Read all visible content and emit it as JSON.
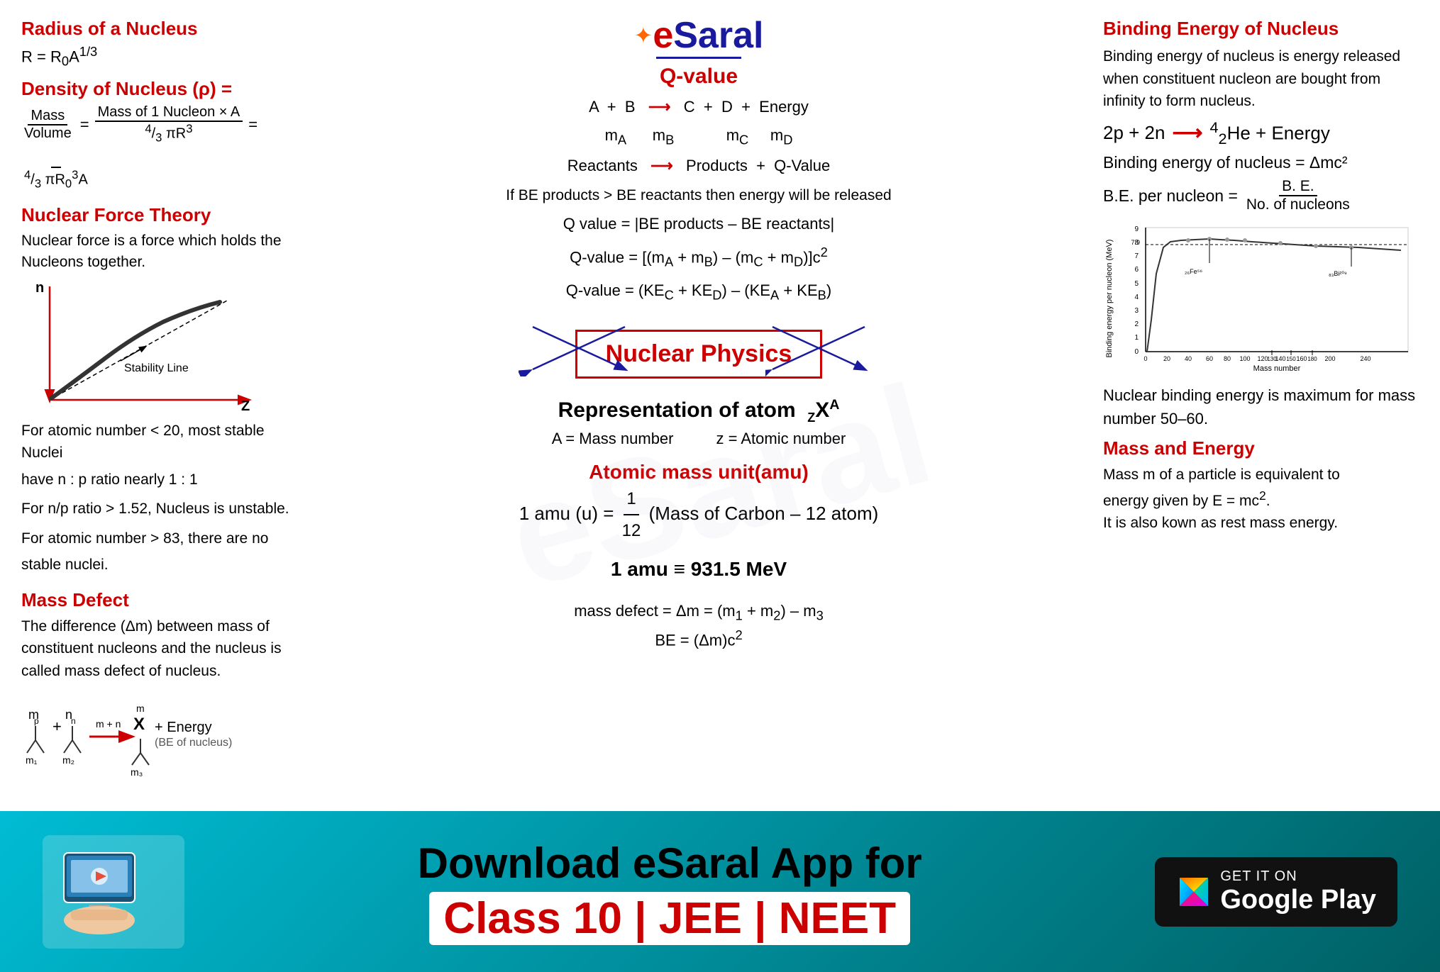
{
  "header": {
    "logo_e": "e",
    "logo_saral": "Saral",
    "logo_star": "✦"
  },
  "left": {
    "radius_title": "Radius of a Nucleus",
    "radius_formula": "R = R₀A¹/³",
    "density_title": "Density of Nucleus (ρ) =",
    "density_fraction_numer": "Mass",
    "density_fraction_denom": "Volume",
    "density_eq1_numer": "Mass of 1 Nucleon × A",
    "density_eq1_denom1": "4/3 πR³",
    "density_eq2_denom2": "4/3 πR₀³A",
    "nf_title": "Nuclear Force Theory",
    "nf_text1": "Nuclear force is a force which holds the",
    "nf_text2": "Nucleons together.",
    "stability_label": "Stability Line",
    "n_label": "n",
    "z_label": "Z",
    "atomic_note1": "For atomic number < 20, most stable Nuclei",
    "atomic_note2": "have n : p ratio nearly 1 : 1",
    "atomic_note3": "For n/p ratio > 1.52, Nucleus is unstable.",
    "atomic_note4": "For atomic number > 83, there are no",
    "atomic_note5": "stable nuclei.",
    "mass_defect_title": "Mass Defect",
    "mass_defect_text1": "The difference (Δm) between mass of",
    "mass_defect_text2": "constituent nucleons and the nucleus is",
    "mass_defect_text3": "called mass defect of nucleus."
  },
  "center": {
    "qvalue_title": "Q-value",
    "reaction_line1": "A  +  B  ⟶  C  +  D  +  Energy",
    "reaction_line2": "m_A        m_B              m_C     m_D",
    "reaction_line3": "Reactants  ⟶  Products  +  Q-Value",
    "if_be": "If BE products > BE reactants then energy will be released",
    "q_formula1": "Q value = |BE products – BE reactants|",
    "q_formula2": "Q-value = [(m_A + m_B) – (m_C + m_D)]c²",
    "q_formula3": "Q-value = (KE_C + KE_D) – (KE_A + KE_B)",
    "nuclear_physics_label": "Nuclear Physics",
    "representation_text": "Representation of atom  Z X^A",
    "rep_a": "A = Mass number",
    "rep_z": "z = Atomic number",
    "amu_title": "Atomic mass unit(amu)",
    "amu_formula1": "1 amu (u) = 1/12 (Mass of Carbon – 12 atom)",
    "amu_formula2": "1 amu ≡ 931.5 MeV",
    "mass_defect_diagram_label": "(BE of nucleus)",
    "mass_defect_eq1": "mass defect = Δm = (m₁ + m₂) – m₃",
    "mass_defect_eq2": "BE = (Δm)c²"
  },
  "right": {
    "binding_title": "Binding Energy of Nucleus",
    "binding_text": "Binding energy of nucleus is energy released when constituent nucleon are bought from infinity to form nucleus.",
    "he_reaction": "2p + 2n ⟶ ⁴₂He + Energy",
    "be_formula": "Binding energy of nucleus = Δmc²",
    "be_per_numer": "B. E.",
    "be_per_denom": "No. of nucleons",
    "be_per_prefix": "B.E. per nucleon = ",
    "nuclear_binding_note": "Nuclear binding energy is maximum for mass number 50–60.",
    "mass_energy_title": "Mass and Energy",
    "mass_energy_text1": "Mass m of a particle is equivalent to",
    "mass_energy_text2": "energy given by E = mc².",
    "mass_energy_text3": "It is also kown as rest mass energy.",
    "chart_y_label": "Binding energy per nucleon (MeV)",
    "chart_x_label": "Mass number",
    "chart_fe_label": "₂₆Fe⁵⁶",
    "chart_bi_label": "₈₃Bi²⁰⁹",
    "chart_max_val": "8.8",
    "chart_y_vals": [
      "9",
      "8",
      "7",
      "6",
      "5",
      "4",
      "3",
      "2",
      "1",
      "0"
    ],
    "chart_x_vals": [
      "0",
      "20",
      "40",
      "60",
      "80",
      "100",
      "120",
      "140",
      "160",
      "200",
      "240"
    ]
  },
  "banner": {
    "title": "Download eSaral App for",
    "subtitle": "Class 10 | JEE | NEET",
    "get_it_on": "GET IT ON",
    "google_play": "Google Play"
  }
}
